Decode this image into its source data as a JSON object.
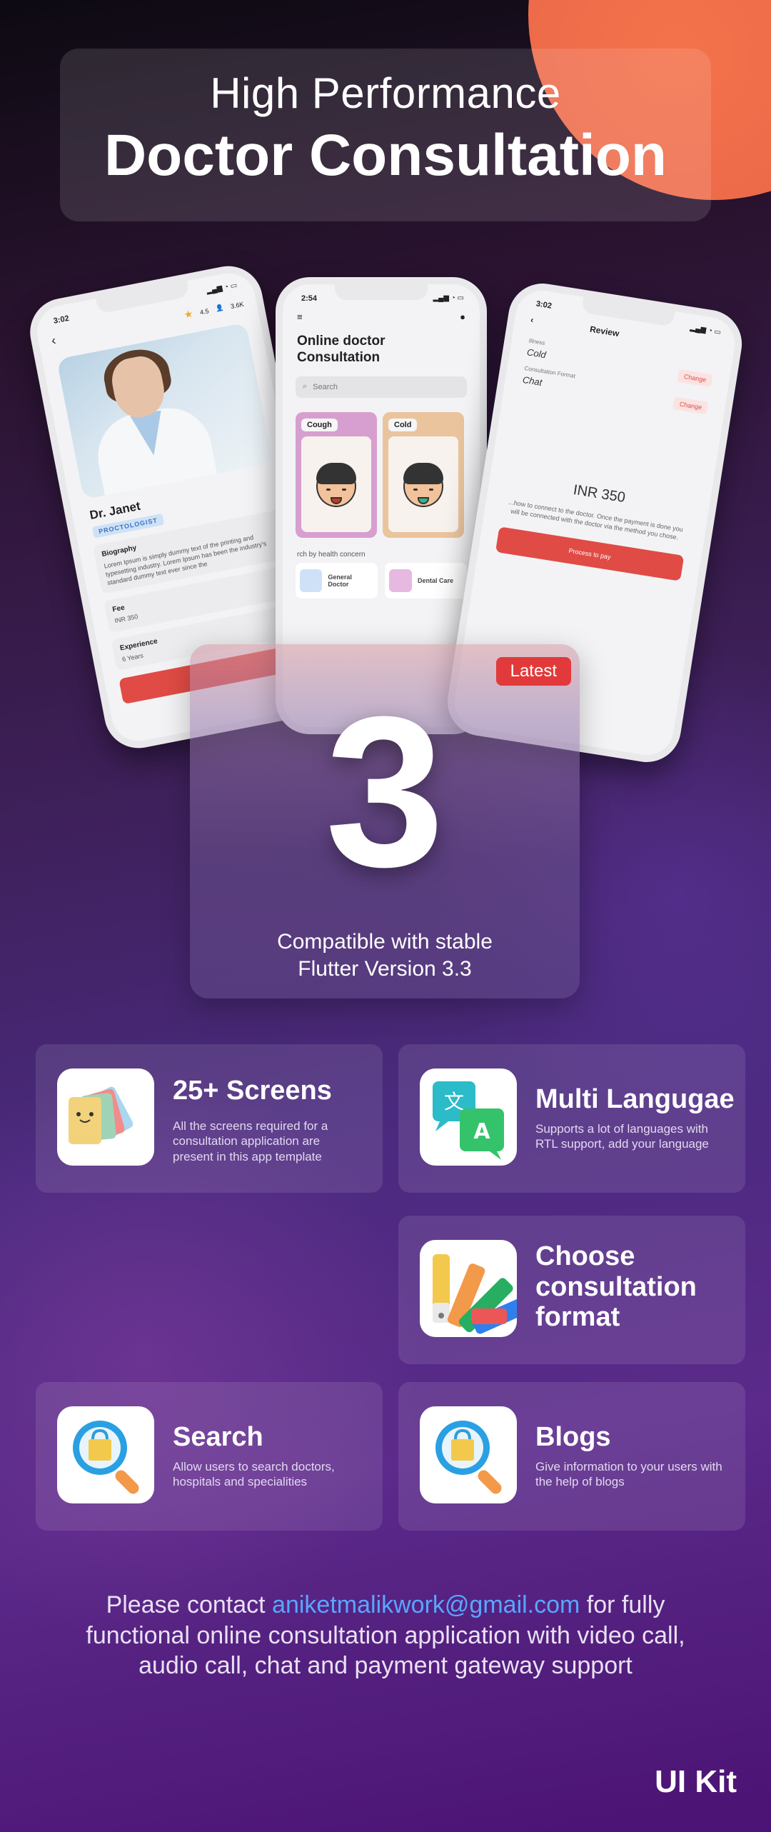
{
  "hero": {
    "subtitle": "High Performance",
    "title": "Doctor Consultation"
  },
  "phone_left": {
    "time": "3:02",
    "rating": "4.5",
    "patients": "3.6K",
    "doctor_name": "Dr. Janet",
    "specialty": "PROCTOLOGIST",
    "biography_label": "Biography",
    "biography_text": "Lorem Ipsum is simply dummy text of the printing and typesetting industry. Lorem Ipsum has been the industry's standard dummy text ever since the",
    "fee_label": "Fee",
    "fee_value": "INR 350",
    "experience_label": "Experience",
    "experience_value": "6 Years"
  },
  "phone_mid": {
    "time": "2:54",
    "title": "Online doctor Consultation",
    "search_placeholder": "Search",
    "symptoms": [
      "Cough",
      "Cold"
    ],
    "concern_heading": "rch by health concern",
    "concerns": [
      "General Doctor",
      "Dental Care"
    ]
  },
  "phone_right": {
    "time": "3:02",
    "title": "Review",
    "illness_label": "Illness",
    "illness_value": "Cold",
    "format_label": "Consultation Format",
    "format_value": "Chat",
    "change_label": "Change",
    "amount": "INR 350",
    "note": "...how to connect to the doctor. Once the payment is done you will be connected with the doctor via the method you chose.",
    "pay_button": "Process to pay"
  },
  "version": {
    "badge": "Latest",
    "number": "3",
    "line1": "Compatible with stable",
    "line2": "Flutter Version 3.3"
  },
  "features": [
    {
      "title": "25+ Screens",
      "desc": "All the screens required for a consultation application are present in this app template",
      "icon": "cards-icon"
    },
    {
      "title": "Multi Langugae",
      "desc": "Supports a lot of languages with RTL support, add your language",
      "icon": "translate-icon"
    },
    {
      "title": "Choose consultation format",
      "desc": "",
      "icon": "palette-icon"
    },
    {
      "title": "Search",
      "desc": "Allow users to search doctors, hospitals and specialities",
      "icon": "search-icon"
    },
    {
      "title": "Blogs",
      "desc": "Give information to your users with the help of blogs",
      "icon": "search-icon"
    }
  ],
  "contact": {
    "before": "Please contact ",
    "email": "aniketmalikwork@gmail.com",
    "after": " for fully functional online consultation application with video call, audio call, chat and payment gateway support"
  },
  "footer_label": "UI Kit",
  "colors": {
    "accent_red": "#e23a3a",
    "link_blue": "#59a6ff",
    "orange": "#ec6a49"
  }
}
